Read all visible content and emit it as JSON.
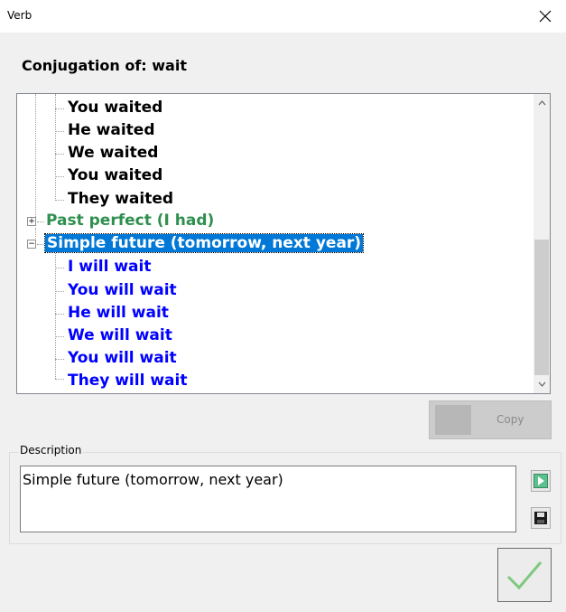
{
  "window": {
    "title": "Verb"
  },
  "heading": "Conjugation of: wait",
  "tree": {
    "past_simple_items": [
      "You waited",
      "He waited",
      "We waited",
      "You waited",
      "They waited"
    ],
    "past_perfect_label": "Past perfect (I had)",
    "simple_future_label": "Simple future (tomorrow, next year)",
    "simple_future_items": [
      "I will wait",
      "You will wait",
      "He will wait",
      "We will wait",
      "You will wait",
      "They will wait"
    ]
  },
  "buttons": {
    "copy_label": "Copy"
  },
  "description": {
    "group_label": "Description",
    "text": "Simple future (tomorrow, next year)"
  },
  "colors": {
    "selection": "#0078d7",
    "leaf_blue": "#0000ff",
    "node_green": "#2f8f4f",
    "ok_check": "#7ec87e"
  }
}
